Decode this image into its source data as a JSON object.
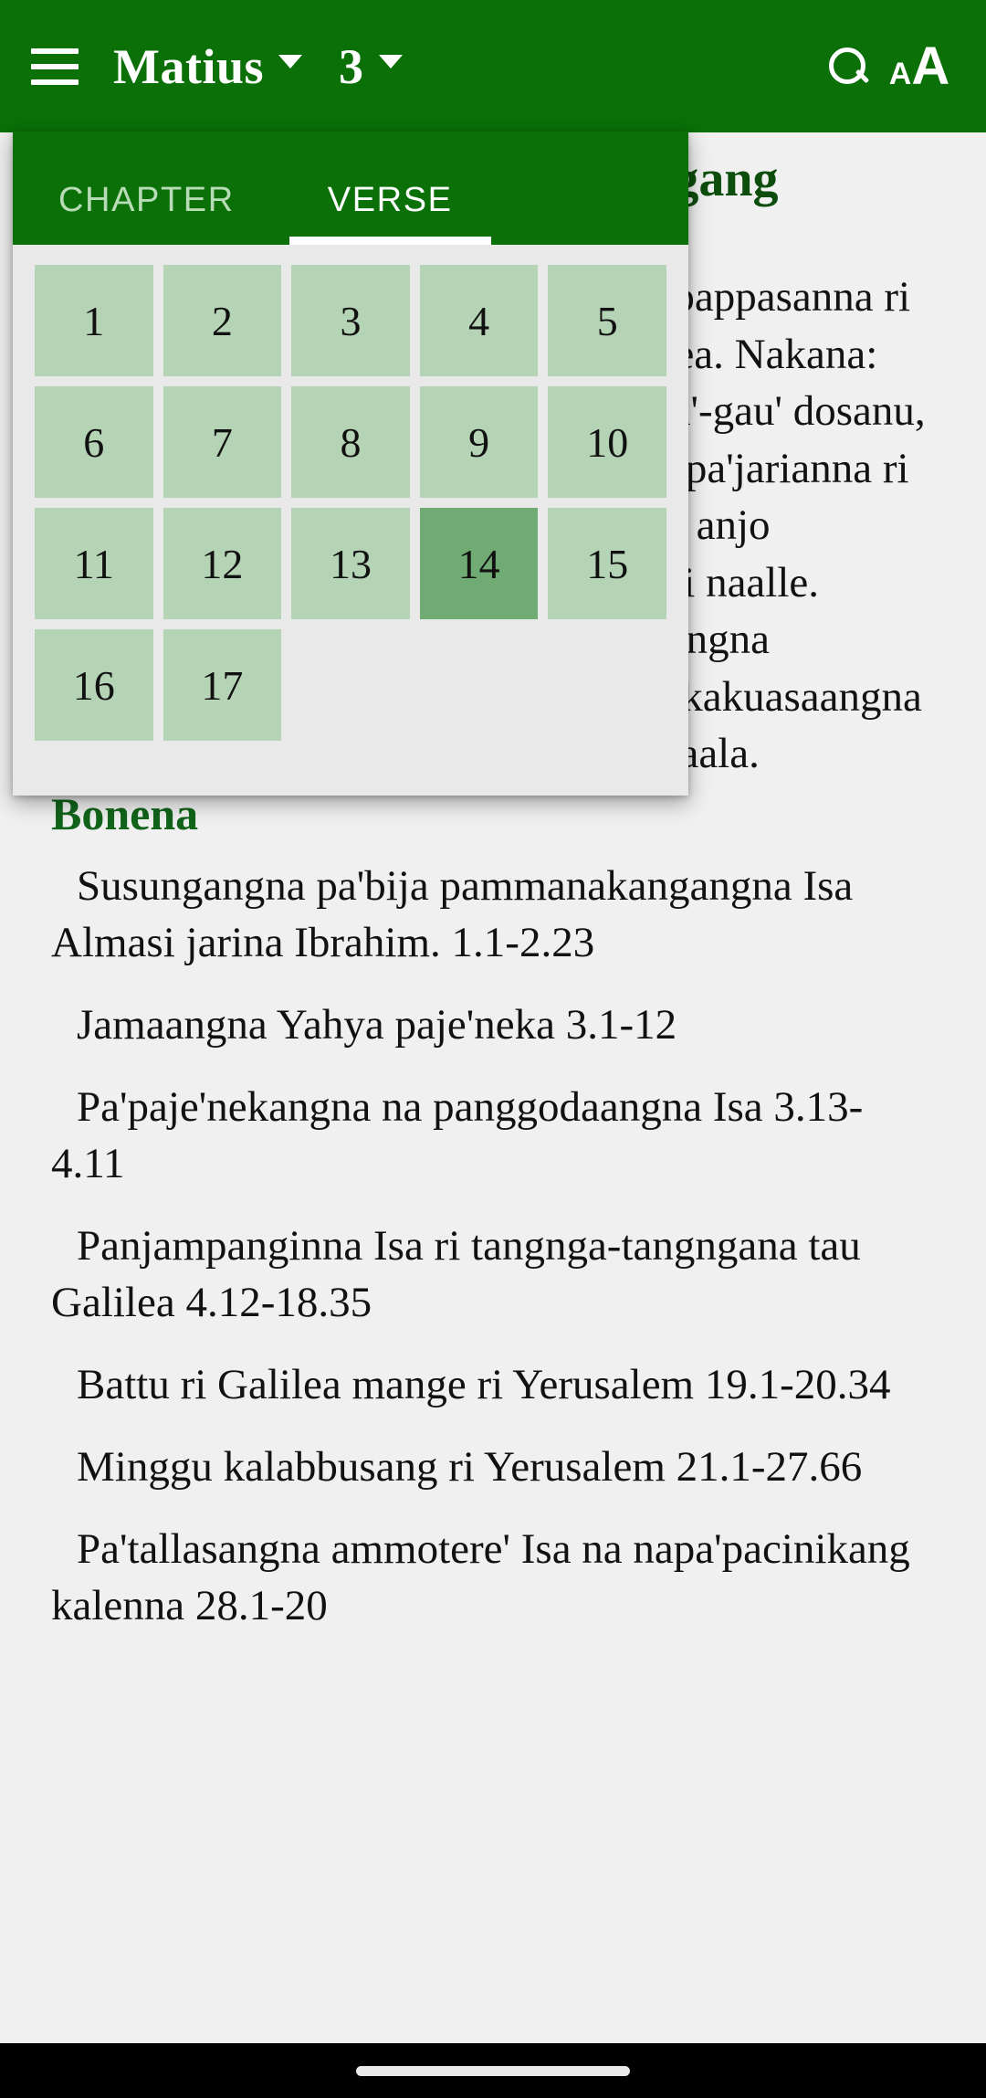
{
  "appbar": {
    "menu_icon": "hamburger-menu-icon",
    "book_label": "Matius",
    "chapter_label": "3",
    "search_icon": "search-icon",
    "textsize_icon": "text-size-icon",
    "textsize_small": "A",
    "textsize_big": "A",
    "bar_color": "#0a7007"
  },
  "picker": {
    "tabs": [
      {
        "label": "CHAPTER",
        "active": false
      },
      {
        "label": "VERSE",
        "active": true
      }
    ],
    "selected_verse": 14,
    "verses": [
      1,
      2,
      3,
      4,
      5,
      6,
      7,
      8,
      9,
      10,
      11,
      12,
      13,
      14,
      15,
      16,
      17
    ],
    "cell_color": "#b5d3b5",
    "selected_color": "#6fab72",
    "panel_color": "#e8e9e8"
  },
  "content": {
    "chapter_heading": "Isa nipantama' ri je'neka siagang nitarimaya nisukirika",
    "paragraph_1": "Ri wattunna anjo Yahya ampabattui pappasanna ri parangna tau ri parang lompona Yudea. Nakana: \"Toboma' ngaseng siagang bokoi gau'-gau' dosanu, nasaba' la'birimmi kana baji' tentang pa'jarianna ri tau kasalama' battu ri Alla-taala, naia anjo kakaraengangna Alla-taala la'birimmi naalle. Iaminne guru lompo tampangngajarangna pa'karaengangna Alla-taala na tunia' kakuasaangna ampa'nassai sikuntu parentana Alla-taala.",
    "section_heading": "Bonena",
    "outline": [
      "Susungangna pa'bija pammanakangangna Isa Almasi jarina Ibrahim. 1.1-2.23",
      "Jamaangna Yahya paje'neka 3.1-12",
      "Pa'paje'nekangna na panggodaangna Isa 3.13-4.11",
      "Panjampanginna Isa ri tangnga-tangngana tau Galilea 4.12-18.35",
      "Battu ri Galilea mange ri Yerusalem 19.1-20.34",
      "Minggu kalabbusang ri Yerusalem 21.1-27.66",
      "Pa'tallasangna ammotere' Isa na napa'pacinikang kalenna 28.1-20"
    ]
  },
  "sysnav": {
    "gesture_handle": "gesture-nav-pill"
  }
}
